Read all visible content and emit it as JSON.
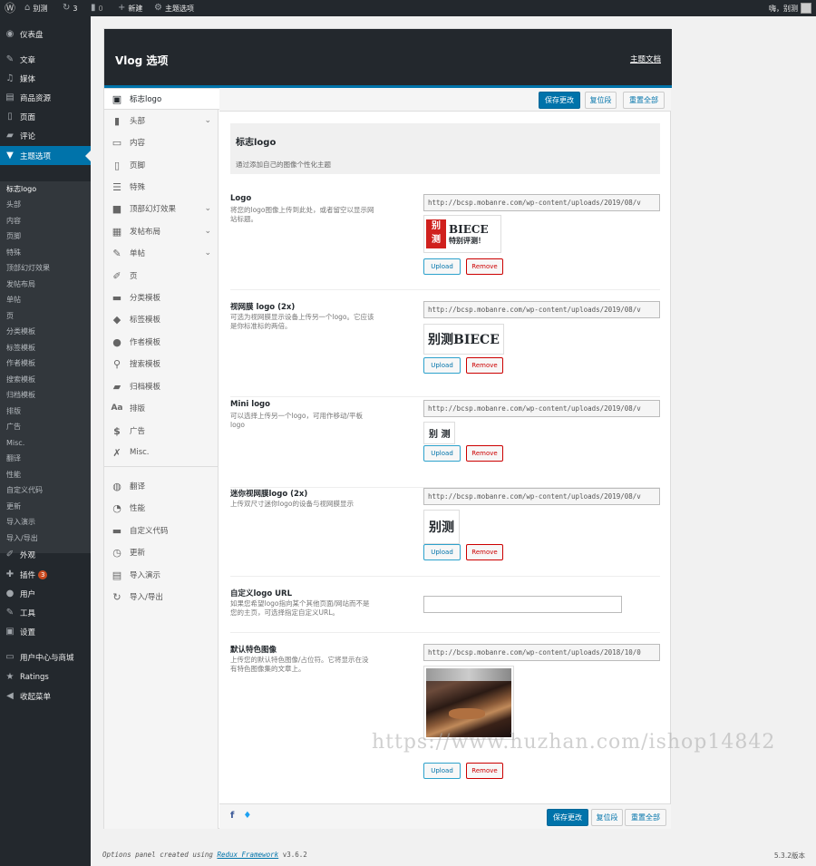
{
  "adminbar": {
    "site_name": "别测",
    "updates_count": "3",
    "comments_count": "0",
    "new_label": "新建",
    "theme_options_label": "主题选项",
    "howdy": "嗨，别测"
  },
  "adminmenu": {
    "items": [
      {
        "label": "仪表盘",
        "icon": "dashboard-icon"
      },
      {
        "label": "文章",
        "icon": "pin-icon"
      },
      {
        "label": "媒体",
        "icon": "media-icon"
      },
      {
        "label": "商品资源",
        "icon": "products-icon"
      },
      {
        "label": "页面",
        "icon": "page-icon"
      },
      {
        "label": "评论",
        "icon": "comments-icon"
      },
      {
        "label": "主题选项",
        "icon": "theme-options-icon"
      }
    ],
    "submenu": [
      "标志logo",
      "头部",
      "内容",
      "页脚",
      "特殊",
      "顶部幻灯效果",
      "发帖布局",
      "单帖",
      "页",
      "分类模板",
      "标签模板",
      "作者模板",
      "搜索模板",
      "归档模板",
      "排版",
      "广告",
      "Misc.",
      "翻译",
      "性能",
      "自定义代码",
      "更新",
      "导入演示",
      "导入/导出"
    ],
    "lower_items": [
      {
        "label": "外观",
        "icon": "appearance-icon"
      },
      {
        "label": "插件",
        "icon": "plugins-icon",
        "badge": "3"
      },
      {
        "label": "用户",
        "icon": "users-icon"
      },
      {
        "label": "工具",
        "icon": "tools-icon"
      },
      {
        "label": "设置",
        "icon": "settings-icon"
      },
      {
        "label": "用户中心与商城",
        "icon": "user-center-icon"
      },
      {
        "label": "Ratings",
        "icon": "star-icon"
      },
      {
        "label": "收起菜单",
        "icon": "collapse-icon"
      }
    ]
  },
  "panel": {
    "title": "Vlog 选项",
    "docs_link": "主题文档",
    "buttons": {
      "save": "保存更改",
      "reset_section": "复位段",
      "reset_all": "重置全部"
    },
    "sidebar": [
      {
        "label": "标志logo",
        "icon": "logo-icon",
        "active": true
      },
      {
        "label": "头部",
        "icon": "bookmark-icon",
        "chevron": true
      },
      {
        "label": "内容",
        "icon": "monitor-icon"
      },
      {
        "label": "页脚",
        "icon": "bookmark-outline-icon"
      },
      {
        "label": "特殊",
        "icon": "list-icon"
      },
      {
        "label": "顶部幻灯效果",
        "icon": "slides-icon",
        "chevron": true
      },
      {
        "label": "发帖布局",
        "icon": "grid-icon",
        "chevron": true
      },
      {
        "label": "单帖",
        "icon": "pencil-icon",
        "chevron": true
      },
      {
        "label": "页",
        "icon": "edit-icon"
      },
      {
        "label": "分类模板",
        "icon": "folder-icon"
      },
      {
        "label": "标签模板",
        "icon": "tag-icon"
      },
      {
        "label": "作者模板",
        "icon": "user-icon"
      },
      {
        "label": "搜索模板",
        "icon": "search-icon"
      },
      {
        "label": "归档模板",
        "icon": "folder-open-icon"
      },
      {
        "label": "排版",
        "icon": "typography-icon"
      },
      {
        "label": "广告",
        "icon": "dollar-icon"
      },
      {
        "label": "Misc.",
        "icon": "wrench-icon"
      },
      {
        "label": "翻译",
        "icon": "globe-icon"
      },
      {
        "label": "性能",
        "icon": "gauge-icon"
      },
      {
        "label": "自定义代码",
        "icon": "code-icon"
      },
      {
        "label": "更新",
        "icon": "clock-icon"
      },
      {
        "label": "导入演示",
        "icon": "import-icon"
      },
      {
        "label": "导入/导出",
        "icon": "refresh-icon"
      }
    ],
    "section": {
      "title": "标志logo",
      "description": "通过添加自己的图像个性化主题"
    },
    "fields": [
      {
        "label": "Logo",
        "description": "将您的logo图像上传到此处，或者留空以显示网站标题。",
        "url": "http://bcsp.mobanre.com/wp-content/uploads/2019/08/v",
        "preview": {
          "box": "别 测",
          "line1": "BIECE",
          "line2": "特别评测！"
        },
        "upload": "Upload",
        "remove": "Remove"
      },
      {
        "label": "视网膜 logo (2x)",
        "description": "可选为视网膜显示设备上传另一个logo。它应该是你标准标的两倍。",
        "url": "http://bcsp.mobanre.com/wp-content/uploads/2019/08/v",
        "preview_text": "别测BIECE",
        "upload": "Upload",
        "remove": "Remove"
      },
      {
        "label": "Mini logo",
        "description": "可以选择上传另一个logo，可用作移动/平板logo",
        "url": "http://bcsp.mobanre.com/wp-content/uploads/2019/08/v",
        "preview_text": "别 测",
        "upload": "Upload",
        "remove": "Remove"
      },
      {
        "label": "迷你视网膜logo (2x)",
        "description": "上传双尺寸迷你logo的设备与视网膜显示",
        "url": "http://bcsp.mobanre.com/wp-content/uploads/2019/08/v",
        "preview_text": "别测",
        "upload": "Upload",
        "remove": "Remove"
      },
      {
        "label": "自定义logo URL",
        "description": "如果您希望logo指向某个其他页面/网站而不是您的主页，可选择指定自定义URL。",
        "value": ""
      },
      {
        "label": "默认特色图像",
        "description": "上传您的默认特色图像/占位符。它将显示在没有特色图像集的文章上。",
        "url": "http://bcsp.mobanre.com/wp-content/uploads/2018/10/0",
        "upload": "Upload",
        "remove": "Remove"
      }
    ]
  },
  "footer": {
    "credit_prefix": "Options panel created using",
    "credit_link": "Redux Framework",
    "credit_version": "v3.6.2",
    "wp_version": "5.3.2版本"
  },
  "watermark": "https://www.huzhan.com/ishop14842",
  "colors": {
    "accent": "#0073aa",
    "menu_bg": "#23282d",
    "submenu_bg": "#32373c",
    "badge": "#ca4a1f",
    "remove": "#cc0000"
  }
}
